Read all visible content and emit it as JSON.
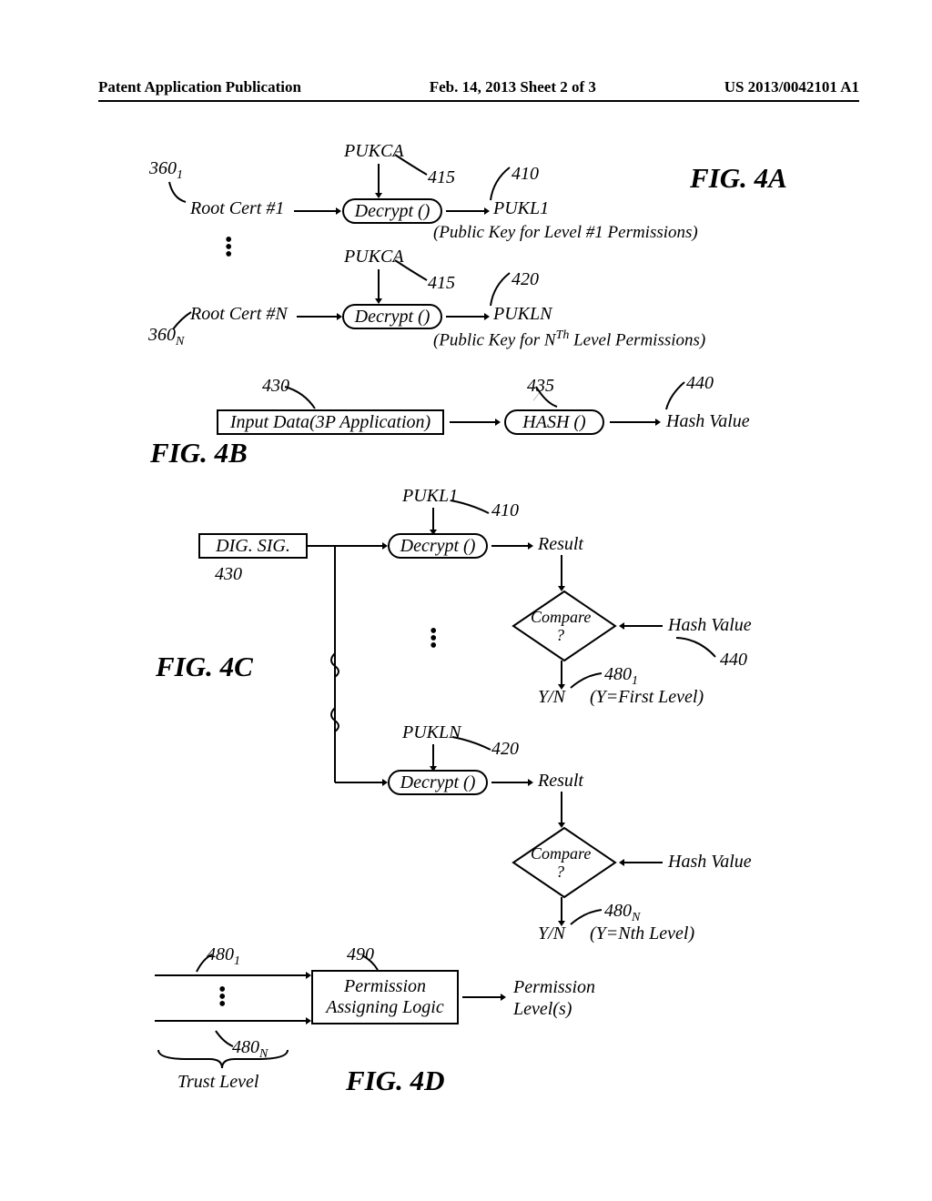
{
  "header": {
    "left": "Patent Application Publication",
    "center": "Feb. 14, 2013  Sheet 2 of 3",
    "right": "US 2013/0042101 A1"
  },
  "figA": {
    "title": "FIG. 4A",
    "ref_360_1": "360",
    "ref_360_N": "360",
    "root1": "Root Cert #1",
    "rootN": "Root Cert #N",
    "pukca": "PUKCA",
    "decrypt": "Decrypt ()",
    "ref_415": "415",
    "ref_410": "410",
    "ref_420": "420",
    "pukl1": "PUKL1",
    "pukln": "PUKLN",
    "sub1_note": "(Public Key for Level #1 Permissions)",
    "subN_note_prefix": "(Public Key for N",
    "subN_note_suffix": " Level Permissions)",
    "th": "Th"
  },
  "figB": {
    "title": "FIG. 4B",
    "ref_430": "430",
    "ref_435": "435",
    "ref_440": "440",
    "input": "Input Data(3P Application)",
    "hash": "HASH ()",
    "hashval": "Hash Value"
  },
  "figC": {
    "title": "FIG. 4C",
    "digsig": "DIG. SIG.",
    "ref_430": "430",
    "pukl1": "PUKL1",
    "ref_410": "410",
    "decrypt": "Decrypt ()",
    "result": "Result",
    "compare": "Compare",
    "q": "?",
    "hashval": "Hash Value",
    "ref_440": "440",
    "pukln": "PUKLN",
    "ref_420": "420",
    "ref_480_1": "480",
    "ref_480_N": "480",
    "yn": "Y/N",
    "yfirst": "(Y=First Level)",
    "ynth": "(Y=Nth Level)"
  },
  "figD": {
    "title": "FIG. 4D",
    "ref_480_1": "480",
    "ref_480_N": "480",
    "ref_490": "490",
    "trust": "Trust Level",
    "pal1": "Permission",
    "pal2": "Assigning Logic",
    "out1": "Permission",
    "out2": "Level(s)"
  },
  "sub1": "1",
  "subN": "N"
}
